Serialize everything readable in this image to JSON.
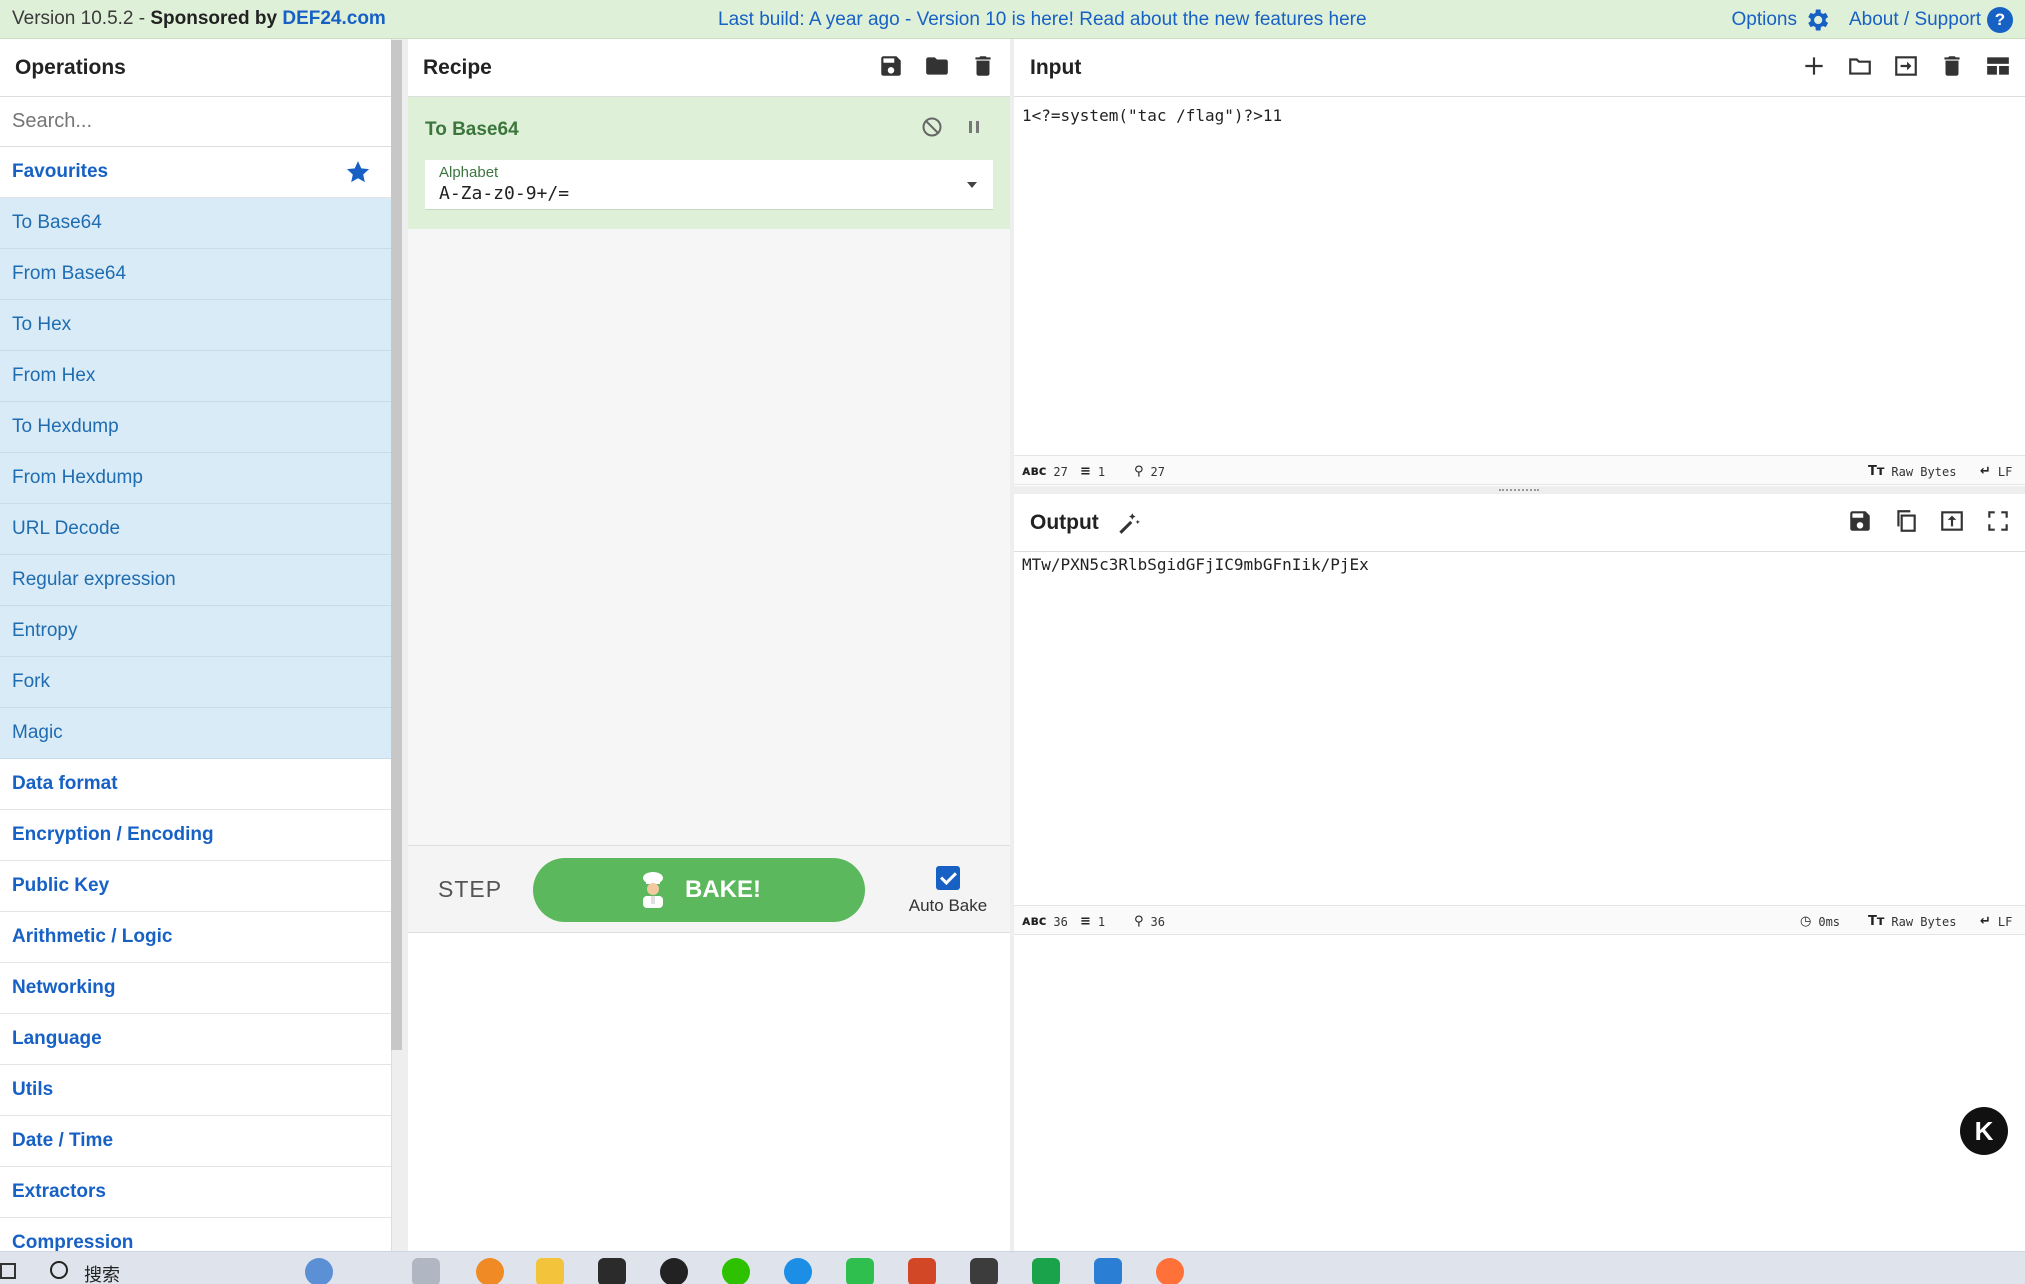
{
  "banner": {
    "version_text": "Version 10.5.2 -",
    "sponsored_label": "Sponsored by",
    "sponsor_link": "DEF24.com",
    "build_notice": "Last build: A year ago - Version 10 is here! Read about the new features here",
    "options_label": "Options",
    "about_label": "About / Support"
  },
  "operations": {
    "title": "Operations",
    "search_placeholder": "Search...",
    "favourites_label": "Favourites",
    "favourite_items": [
      "To Base64",
      "From Base64",
      "To Hex",
      "From Hex",
      "To Hexdump",
      "From Hexdump",
      "URL Decode",
      "Regular expression",
      "Entropy",
      "Fork",
      "Magic"
    ],
    "categories": [
      "Data format",
      "Encryption / Encoding",
      "Public Key",
      "Arithmetic / Logic",
      "Networking",
      "Language",
      "Utils",
      "Date / Time",
      "Extractors",
      "Compression"
    ]
  },
  "recipe": {
    "title": "Recipe",
    "operation_name": "To Base64",
    "alphabet_label": "Alphabet",
    "alphabet_value": "A-Za-z0-9+/=",
    "step_label": "STEP",
    "bake_label": "BAKE!",
    "auto_bake_label": "Auto Bake",
    "auto_bake_checked": true
  },
  "input": {
    "title": "Input",
    "text": "1<?=system(\"tac /flag\")?>11",
    "length": "27",
    "lines": "1",
    "position": "27",
    "encoding": "Raw Bytes",
    "eol": "LF"
  },
  "output": {
    "title": "Output",
    "text": "MTw/PXN5c3RlbSgidGFjIC9mbGFnIik/PjEx",
    "length": "36",
    "lines": "1",
    "position": "36",
    "time": "0ms",
    "encoding": "Raw Bytes",
    "eol": "LF"
  },
  "floating_button_label": "K",
  "taskbar": {
    "search_label": "搜索"
  },
  "colors": {
    "banner_bg": "#dff0d8",
    "accent_blue": "#1761c5",
    "favourite_bg": "#d9ebf6",
    "recipe_card_bg": "#dff0d8",
    "bake_green": "#5cb85c"
  }
}
